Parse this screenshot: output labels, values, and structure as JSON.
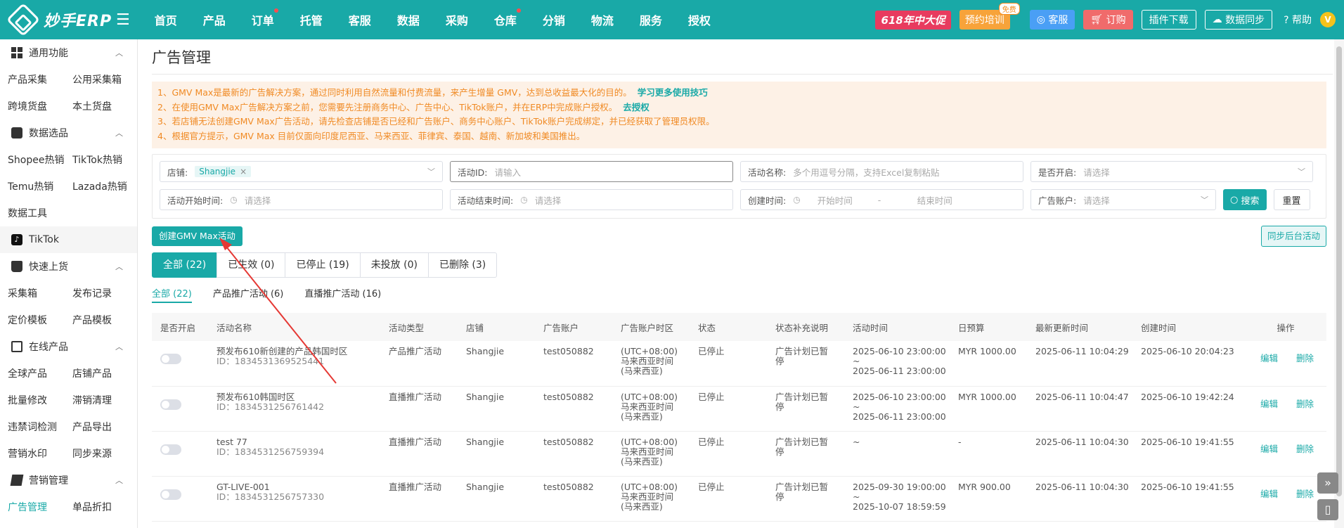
{
  "brand": "妙手ERP",
  "nav": [
    "首页",
    "产品",
    "订单",
    "托管",
    "客服",
    "数据",
    "采购",
    "仓库",
    "分销",
    "物流",
    "服务",
    "授权"
  ],
  "topright": {
    "promo": "618年中大促",
    "training": "预约培训",
    "free_badge": "免费",
    "kefu": "客服",
    "order": "订购",
    "plugin": "插件下载",
    "datasync": "数据同步",
    "help": "帮助",
    "avatar": "V"
  },
  "sidebar": {
    "g1": "通用功能",
    "g1_items": [
      "产品采集",
      "公用采集箱",
      "跨境货盘",
      "本土货盘"
    ],
    "g2": "数据选品",
    "g2_items": [
      "Shopee热销",
      "TikTok热销",
      "Temu热销",
      "Lazada热销",
      "数据工具"
    ],
    "tiktok": "TikTok",
    "g3": "快速上货",
    "g3_items": [
      "采集箱",
      "发布记录",
      "定价模板",
      "产品模板"
    ],
    "g4": "在线产品",
    "g4_items": [
      "全球产品",
      "店铺产品",
      "批量修改",
      "滞销清理",
      "违禁词检测",
      "产品导出",
      "营销水印",
      "同步来源"
    ],
    "g5": "营销管理",
    "g5_items": [
      "广告管理",
      "单品折扣"
    ]
  },
  "page": {
    "title": "广告管理",
    "notices": [
      "1、GMV Max是最新的广告解决方案，通过同时利用自然流量和付费流量，来产生增量 GMV，达到总收益最大化的目的。",
      "2、在使用GMV Max广告解决方案之前，您需要先注册商务中心、广告中心、TikTok账户，并在ERP中完成账户授权。",
      "3、若店铺无法创建GMV Max广告活动，请先检查店铺是否已经和广告账户、商务中心账户、TikTok账户完成绑定，并已经获取了管理员权限。",
      "4、根据官方提示，GMV Max 目前仅面向印度尼西亚、马来西亚、菲律宾、泰国、越南、新加坡和美国推出。"
    ],
    "link_learn": "学习更多使用技巧",
    "link_auth": "去授权"
  },
  "filters": {
    "shop_label": "店铺:",
    "shop_chip": "Shangjie",
    "activity_id_label": "活动ID:",
    "activity_id_ph": "请输入",
    "activity_name_label": "活动名称:",
    "activity_name_ph": "多个用逗号分隔，支持Excel复制粘贴",
    "enabled_label": "是否开启:",
    "select_ph": "请选择",
    "start_label": "活动开始时间:",
    "end_label": "活动结束时间:",
    "created_label": "创建时间:",
    "start_time_ph": "开始时间",
    "dash": "-",
    "end_time_ph": "结束时间",
    "ad_account_label": "广告账户:",
    "search": "搜索",
    "reset": "重置"
  },
  "actions": {
    "create": "创建GMV Max活动",
    "sync": "同步后台活动"
  },
  "status_tabs": [
    "全部 (22)",
    "已生效 (0)",
    "已停止 (19)",
    "未投放 (0)",
    "已删除 (3)"
  ],
  "type_tabs": [
    "全部 (22)",
    "产品推广活动 (6)",
    "直播推广活动 (16)"
  ],
  "table": {
    "headers": [
      "是否开启",
      "活动名称",
      "活动类型",
      "店铺",
      "广告账户",
      "广告账户时区",
      "状态",
      "状态补充说明",
      "活动时间",
      "日预算",
      "最新更新时间",
      "创建时间",
      "操作"
    ],
    "edit": "编辑",
    "delete": "删除",
    "rows": [
      {
        "name": "预发布610新创建的产品韩国时区",
        "id": "ID：1834531369525441",
        "type": "产品推广活动",
        "shop": "Shangjie",
        "account": "test050882",
        "tz1": "(UTC+08:00)",
        "tz2": "马来西亚时间",
        "tz3": "(马来西亚)",
        "status": "已停止",
        "note1": "广告计划已暂",
        "note2": "停",
        "time1": "2025-06-10 23:00:00",
        "time2": "~",
        "time3": "2025-06-11 23:00:00",
        "budget": "MYR 1000.00",
        "updated": "2025-06-11 10:04:29",
        "created": "2025-06-10 20:04:23"
      },
      {
        "name": "预发布610韩国时区",
        "id": "ID：1834531256761442",
        "type": "直播推广活动",
        "shop": "Shangjie",
        "account": "test050882",
        "tz1": "(UTC+08:00)",
        "tz2": "马来西亚时间",
        "tz3": "(马来西亚)",
        "status": "已停止",
        "note1": "广告计划已暂",
        "note2": "停",
        "time1": "2025-06-10 23:00:00",
        "time2": "~",
        "time3": "2025-06-11 23:00:00",
        "budget": "MYR 1000.00",
        "updated": "2025-06-11 10:04:47",
        "created": "2025-06-10 19:42:24"
      },
      {
        "name": "test 77",
        "id": "ID：1834531256759394",
        "type": "直播推广活动",
        "shop": "Shangjie",
        "account": "test050882",
        "tz1": "(UTC+08:00)",
        "tz2": "马来西亚时间",
        "tz3": "(马来西亚)",
        "status": "已停止",
        "note1": "广告计划已暂",
        "note2": "停",
        "time1": "~",
        "time2": "",
        "time3": "",
        "budget": "-",
        "updated": "2025-06-11 10:04:30",
        "created": "2025-06-10 19:41:55"
      },
      {
        "name": "GT-LIVE-001",
        "id": "ID：1834531256757330",
        "type": "直播推广活动",
        "shop": "Shangjie",
        "account": "test050882",
        "tz1": "(UTC+08:00)",
        "tz2": "马来西亚时间",
        "tz3": "(马来西亚)",
        "status": "已停止",
        "note1": "广告计划已暂",
        "note2": "停",
        "time1": "2025-09-30 19:00:00",
        "time2": "~",
        "time3": "2025-10-07 18:59:59",
        "budget": "MYR 900.00",
        "updated": "2025-06-11 10:04:30",
        "created": "2025-06-10 19:41:55"
      }
    ]
  },
  "colors": {
    "primary": "#19a9a7",
    "notice_text": "#f08a24",
    "arrow": "#e53935"
  }
}
